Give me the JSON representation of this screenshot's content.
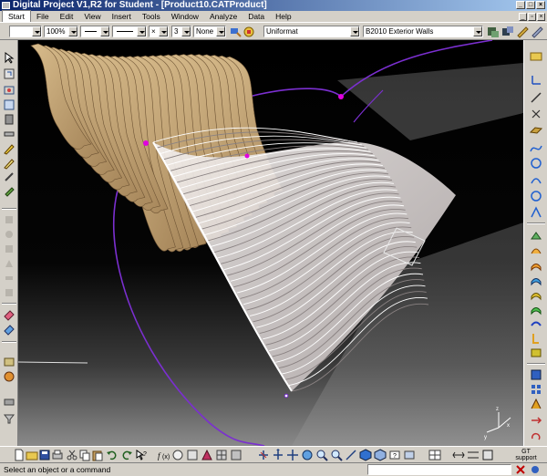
{
  "window": {
    "title": "Digital Project V1,R2 for Student - [Product10.CATProduct]",
    "controls": [
      "minimize",
      "maximize",
      "close"
    ]
  },
  "menubar": {
    "items": [
      "Start",
      "File",
      "Edit",
      "View",
      "Insert",
      "Tools",
      "Window",
      "Analyze",
      "Data",
      "Help"
    ],
    "selected": "Start"
  },
  "properties_toolbar": {
    "fill_color": "",
    "zoom": "100%",
    "line_type": "",
    "line_thickness": "",
    "point_symbol": "×",
    "layer_number": "3",
    "layer": "None",
    "surface_format": "Uniformat",
    "assembly": "B2010 Exterior Walls"
  },
  "viewport": {
    "background_top": "#000000",
    "background_bottom": "#8a8a8a",
    "accent_curve_color": "#7b2fd0",
    "point_color": "#e000e0"
  },
  "bottom_toolbar": {
    "gt_label_line1": "GT",
    "gt_label_line2": "support"
  },
  "statusbar": {
    "message": "Select an object or a command",
    "command_input": ""
  }
}
